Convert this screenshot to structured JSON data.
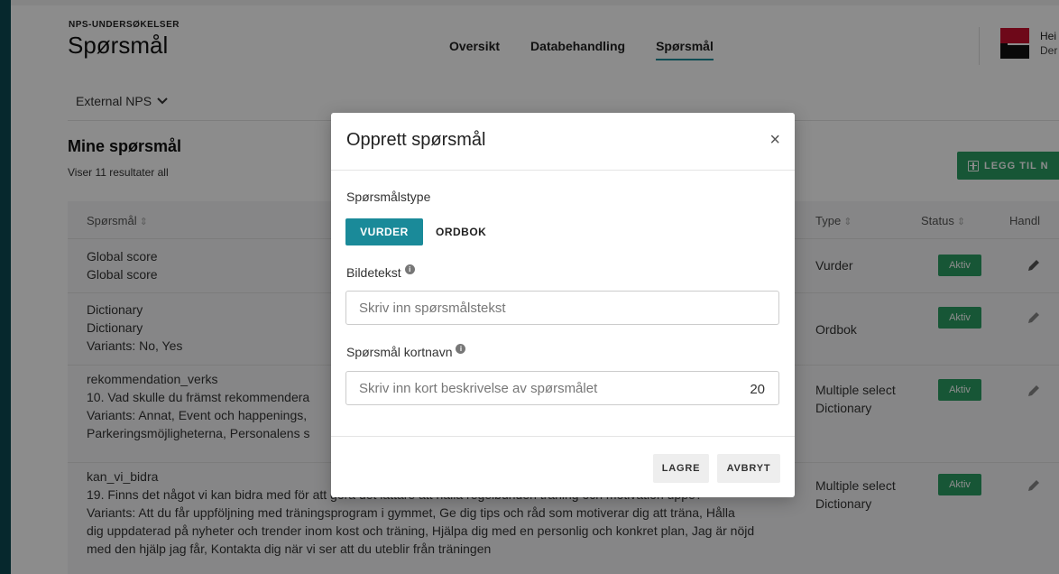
{
  "header": {
    "app_label": "NPS-UNDERSØKELSER",
    "title": "Spørsmål",
    "nav": [
      {
        "label": "Oversikt"
      },
      {
        "label": "Databehandling"
      },
      {
        "label": "Spørsmål"
      }
    ],
    "user_greeting": "Hei",
    "user_sub": "Der"
  },
  "context": {
    "selected": "External NPS"
  },
  "section": {
    "title": "Mine spørsmål",
    "result_count": "Viser 11 resultater all",
    "add_button": "LEGG TIL N"
  },
  "table": {
    "columns": [
      "Spørsmål",
      "Type",
      "Status",
      "Handl"
    ],
    "rows": [
      {
        "lines": [
          "Global score",
          "Global score"
        ],
        "type": [
          "Vurder"
        ],
        "status": "Aktiv"
      },
      {
        "lines": [
          "Dictionary",
          "Dictionary",
          "Variants: No, Yes"
        ],
        "type": [
          "Ordbok"
        ],
        "status": "Aktiv"
      },
      {
        "lines": [
          "rekommendation_verks",
          "10. Vad skulle du främst rekommendera",
          "Variants: Annat, Event och happenings,",
          "Parkeringsmöjligheterna, Personalens s"
        ],
        "type": [
          "Multiple select",
          "Dictionary"
        ],
        "status": "Aktiv"
      },
      {
        "lines": [
          "kan_vi_bidra",
          "19. Finns det något vi kan bidra med för att göra det lättare att hålla regelbunden träning och motivation uppe?",
          "Variants: Att du får uppföljning med träningsprogram i gymmet, Ge dig tips och råd som motiverar dig att träna, Hålla",
          "dig uppdaterad på nyheter och trender inom kost och träning, Hjälpa dig med en personlig och konkret plan, Jag är nöjd",
          "med den hjälp jag får, Kontakta dig när vi ser att du uteblir från träningen"
        ],
        "type": [
          "Multiple select",
          "Dictionary"
        ],
        "status": "Aktiv"
      }
    ]
  },
  "modal": {
    "title": "Opprett spørsmål",
    "close": "×",
    "type_label": "Spørsmålstype",
    "type_options": [
      "VURDER",
      "ORDBOK"
    ],
    "caption_label": "Bildetekst",
    "caption_placeholder": "Skriv inn spørsmålstekst",
    "shortname_label": "Spørsmål kortnavn",
    "shortname_placeholder": "Skriv inn kort beskrivelse av spørsmålet",
    "shortname_counter": "20",
    "save": "LAGRE",
    "cancel": "AVBRYT"
  },
  "colors": {
    "accent": "#1a8a99",
    "success": "#2a9d63",
    "sidebar": "#0b4a52",
    "brand_red": "#c8102e"
  }
}
